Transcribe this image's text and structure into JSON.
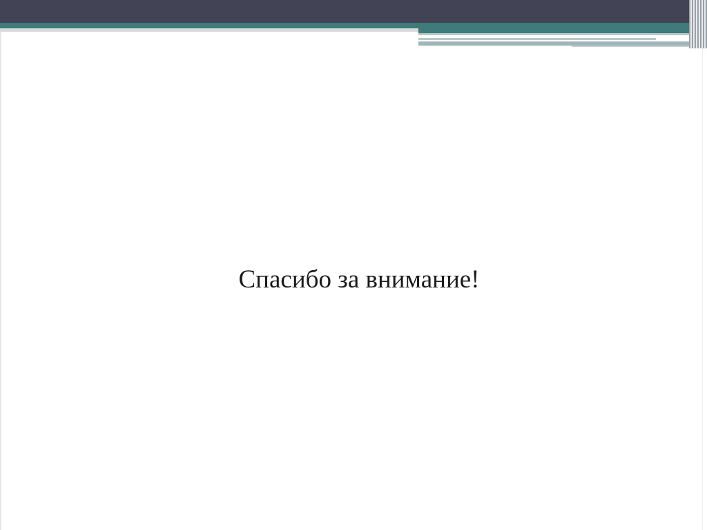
{
  "slide": {
    "closing_text": "Спасибо за внимание!"
  },
  "theme": {
    "header_dark": "#424456",
    "header_teal": "#3e7b7a",
    "accent_light": "#b9c7c8",
    "background": "#ffffff",
    "text": "#1b1b1b"
  }
}
